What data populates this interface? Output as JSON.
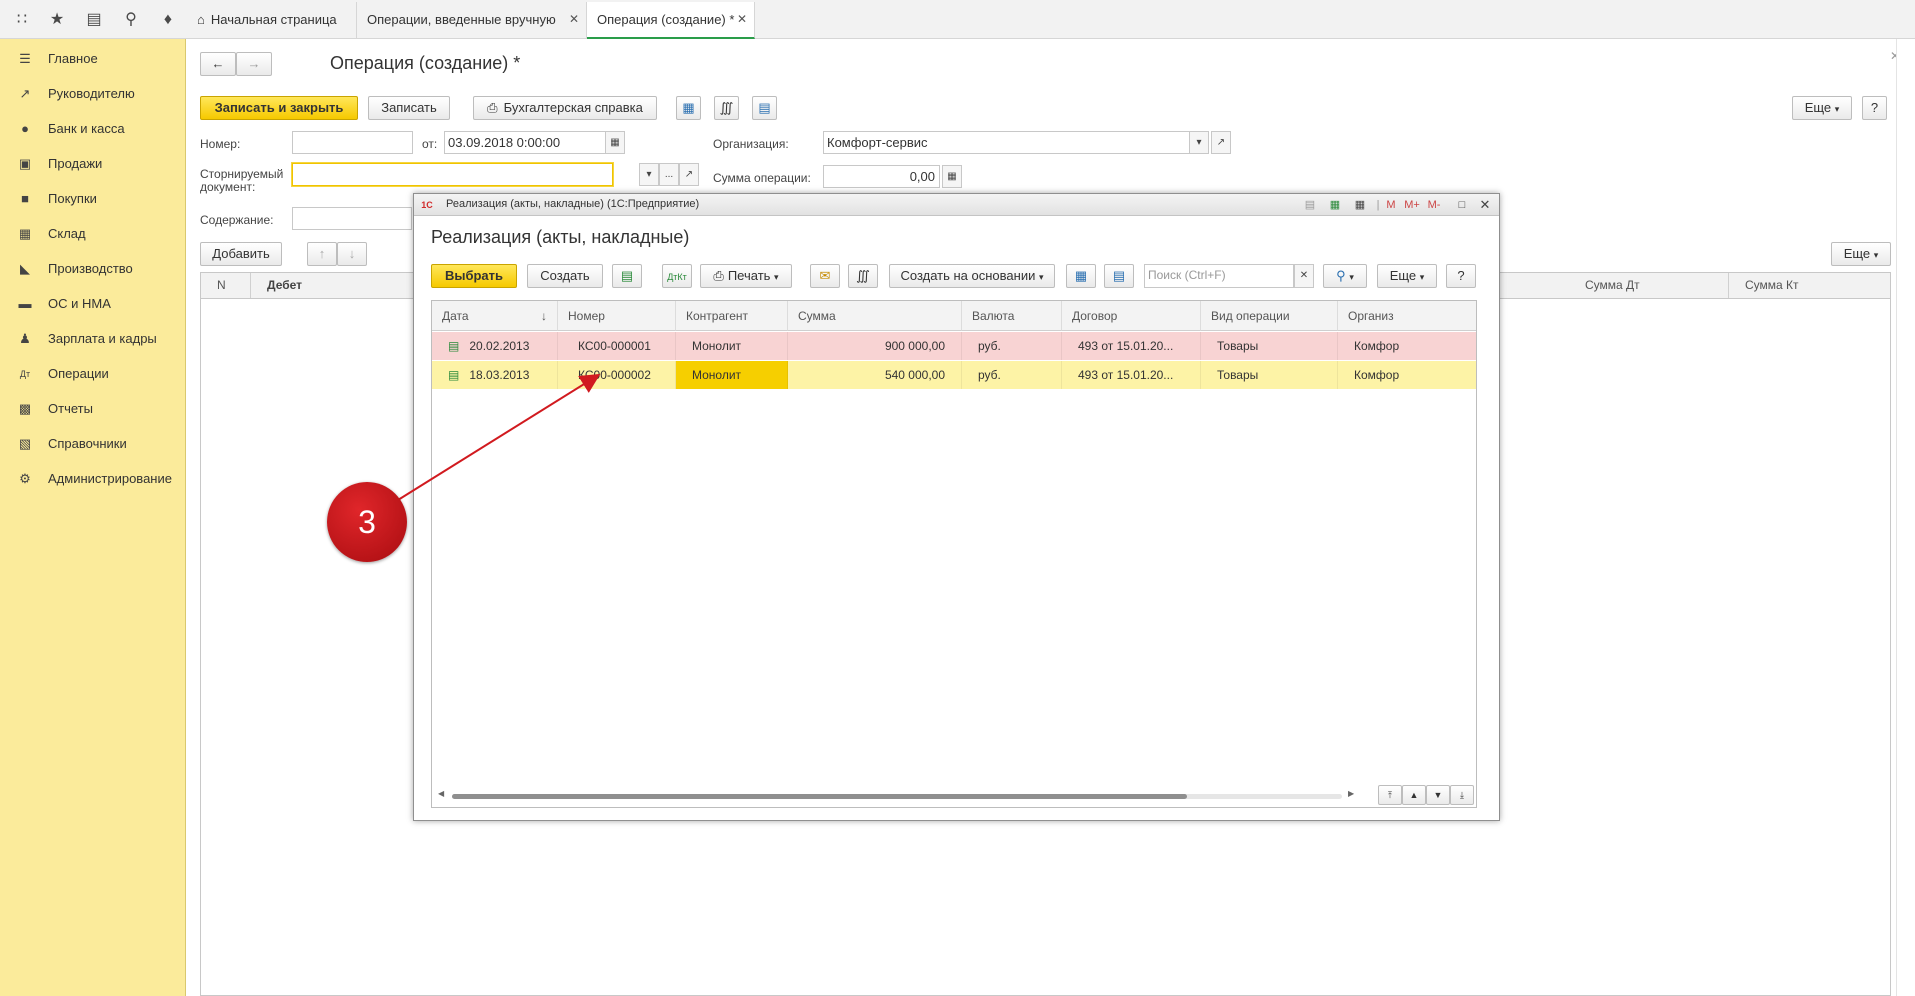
{
  "tabs": [
    {
      "label": "Начальная страница"
    },
    {
      "label": "Операции, введенные вручную"
    },
    {
      "label": "Операция (создание) *"
    }
  ],
  "sidebar": {
    "items": [
      {
        "label": "Главное",
        "icon": "menu-icon"
      },
      {
        "label": "Руководителю",
        "icon": "chart-icon"
      },
      {
        "label": "Банк и касса",
        "icon": "ruble-icon"
      },
      {
        "label": "Продажи",
        "icon": "bag-icon"
      },
      {
        "label": "Покупки",
        "icon": "cart-icon"
      },
      {
        "label": "Склад",
        "icon": "warehouse-icon"
      },
      {
        "label": "Производство",
        "icon": "factory-icon"
      },
      {
        "label": "ОС и НМА",
        "icon": "car-icon"
      },
      {
        "label": "Зарплата и кадры",
        "icon": "person-icon"
      },
      {
        "label": "Операции",
        "icon": "dt-kt-icon"
      },
      {
        "label": "Отчеты",
        "icon": "report-icon"
      },
      {
        "label": "Справочники",
        "icon": "book-icon"
      },
      {
        "label": "Администрирование",
        "icon": "gear-icon"
      }
    ]
  },
  "form": {
    "title": "Операция (создание) *",
    "save_close_label": "Записать и закрыть",
    "save_label": "Записать",
    "accounting_note_label": "Бухгалтерская справка",
    "more_label": "Еще",
    "help_label": "?",
    "number_label": "Номер:",
    "number_value": "",
    "date_label": "от:",
    "date_value": "03.09.2018  0:00:00",
    "org_label": "Организация:",
    "org_value": "Комфорт-сервис",
    "reversed_label_1": "Сторнируемый",
    "reversed_label_2": "документ:",
    "sum_label": "Сумма операции:",
    "sum_value": "0,00",
    "content_label": "Содержание:",
    "add_label": "Добавить",
    "grid_more_label": "Еще",
    "columns": [
      "N",
      "Дебет",
      "Сумма Дт",
      "Сумма Кт"
    ]
  },
  "modal": {
    "window_title": "Реализация (акты, накладные)  (1С:Предприятие)",
    "title": "Реализация (акты, накладные)",
    "select_label": "Выбрать",
    "create_label": "Создать",
    "print_label": "Печать",
    "create_based_label": "Создать на основании",
    "search_placeholder": "Поиск (Ctrl+F)",
    "more_label": "Еще",
    "help_label": "?",
    "win_m": "M",
    "win_mplus": "M+",
    "win_mminus": "M-",
    "columns": [
      "Дата",
      "Номер",
      "Контрагент",
      "Сумма",
      "Валюта",
      "Договор",
      "Вид операции",
      "Организ"
    ],
    "rows": [
      {
        "date": "20.02.2013",
        "number": "КС00-000001",
        "counterparty": "Монолит",
        "sum": "900 000,00",
        "currency": "руб.",
        "contract": "493 от 15.01.20...",
        "op_type": "Товары",
        "org": "Комфор"
      },
      {
        "date": "18.03.2013",
        "number": "КС00-000002",
        "counterparty": "Монолит",
        "sum": "540 000,00",
        "currency": "руб.",
        "contract": "493 от 15.01.20...",
        "op_type": "Товары",
        "org": "Комфор"
      }
    ]
  },
  "annotation": {
    "label": "3"
  },
  "colors": {
    "sidebar": "#fbeb9b",
    "accent_yellow": "#f6c900",
    "row_pink": "#f8d3d3",
    "row_yellow": "#fdf3a6",
    "badge_red": "#c4141a"
  }
}
